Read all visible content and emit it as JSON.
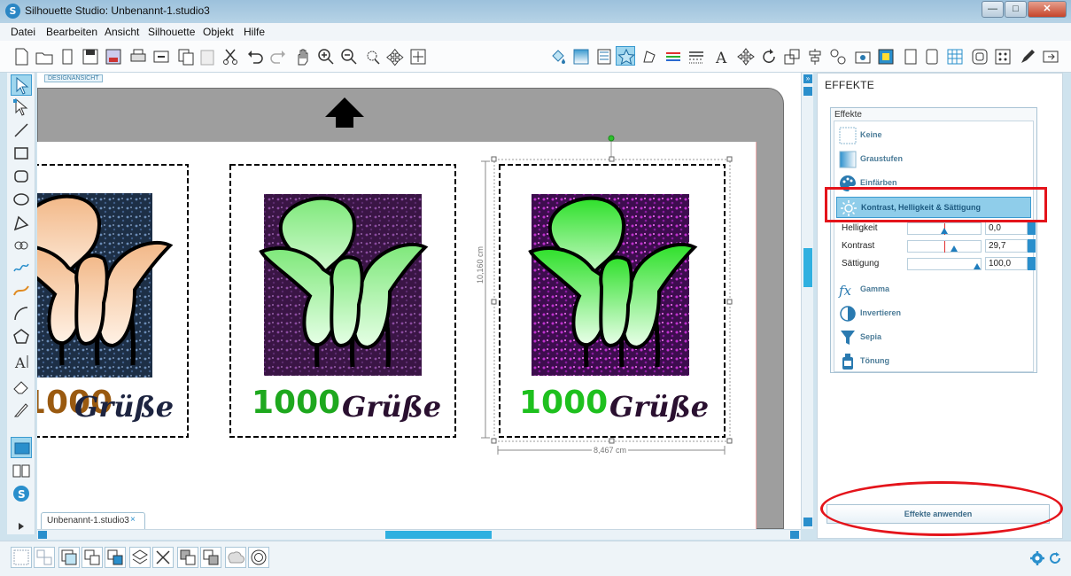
{
  "window": {
    "title": "Silhouette Studio: Unbenannt-1.studio3",
    "app_icon": "S",
    "buttons": {
      "minimize": "—",
      "maximize": "□",
      "close": "✕"
    }
  },
  "menu": [
    "Datei",
    "Bearbeiten",
    "Ansicht",
    "Silhouette",
    "Objekt",
    "Hilfe"
  ],
  "canvas": {
    "view_tag": "DESIGNANSICHT",
    "doc_tab": "Unbenannt-1.studio3",
    "doc_tab_close": "×",
    "stamps": [
      {
        "number": "1000",
        "text": "Grüße"
      },
      {
        "number": "1000",
        "text": "Grüße"
      },
      {
        "number": "1000",
        "text": "Grüße"
      }
    ],
    "dim_height": "10,160 cm",
    "dim_width": "8,467 cm"
  },
  "panel": {
    "title": "EFFEKTE",
    "group_label": "Effekte",
    "effects": [
      {
        "label": "Keine",
        "icon": "none-effect-icon"
      },
      {
        "label": "Graustufen",
        "icon": "grayscale-icon"
      },
      {
        "label": "Einfärben",
        "icon": "palette-icon"
      },
      {
        "label": "Kontrast, Helligkeit & Sättigung",
        "icon": "sun-icon"
      },
      {
        "label": "Gamma",
        "icon": "fx-icon"
      },
      {
        "label": "Invertieren",
        "icon": "invert-icon"
      },
      {
        "label": "Sepia",
        "icon": "funnel-icon"
      },
      {
        "label": "Tönung",
        "icon": "bottle-icon"
      }
    ],
    "sliders": [
      {
        "label": "Helligkeit",
        "value": "0,0",
        "fraction": 0.5
      },
      {
        "label": "Kontrast",
        "value": "29,7",
        "fraction": 0.65
      },
      {
        "label": "Sättigung",
        "value": "100,0",
        "fraction": 1.0
      }
    ],
    "apply_label": "Effekte anwenden"
  },
  "colors": {
    "accent": "#3a9ad0",
    "highlight": "#e4141b",
    "stamp_green": "#1ec01e",
    "stamp_text": "#2a1030"
  }
}
